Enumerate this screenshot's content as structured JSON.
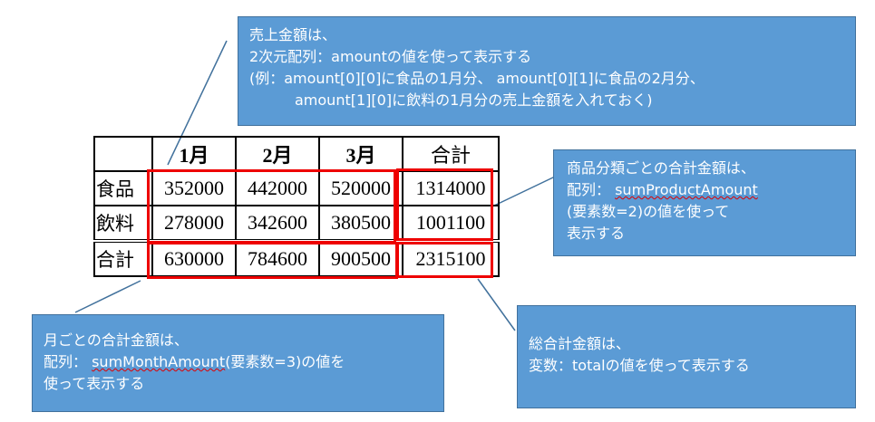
{
  "callouts": {
    "amount": [
      "売上金額は、",
      "2次元配列：amountの値を使って表示する",
      "(例：amount[0][0]に食品の1月分、 amount[0][1]に食品の2月分、",
      "amount[1][0]に飲料の1月分の売上金額を入れておく)"
    ],
    "product": {
      "l1": "商品分類ごとの合計金額は、",
      "l2_prefix": "配列： ",
      "l2_var": "sumProductAmount",
      "l3": "(要素数=2)の値を使って",
      "l4": "表示する"
    },
    "month": {
      "l1": "月ごとの合計金額は、",
      "l2_prefix": "配列： ",
      "l2_var": "sumMonthAmount",
      "l2_suffix": "(要素数=3)の値を",
      "l3": "使って表示する"
    },
    "total": [
      "総合計金額は、",
      "変数：totalの値を使って表示する"
    ]
  },
  "table": {
    "headers": [
      "",
      "1月",
      "2月",
      "3月",
      "合計"
    ],
    "rows": [
      {
        "label": "食品",
        "values": [
          "352000",
          "442000",
          "520000",
          "1314000"
        ]
      },
      {
        "label": "飲料",
        "values": [
          "278000",
          "342600",
          "380500",
          "1001100"
        ]
      },
      {
        "label": "合計",
        "values": [
          "630000",
          "784600",
          "900500",
          "2315100"
        ]
      }
    ]
  },
  "colors": {
    "callout": "#5b9bd5",
    "highlight": "#ee0000"
  }
}
